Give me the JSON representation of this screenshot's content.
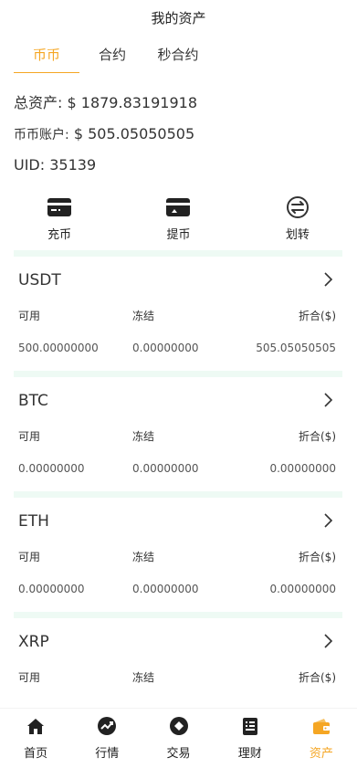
{
  "header": {
    "title": "我的资产"
  },
  "tabs": [
    {
      "label": "币币",
      "active": true
    },
    {
      "label": "合约",
      "active": false
    },
    {
      "label": "秒合约",
      "active": false
    }
  ],
  "summary": {
    "total_label": "总资产:",
    "total_value": "$ 1879.83191918",
    "account_label": "币币账户:",
    "account_value": "$ 505.05050505",
    "uid_label": "UID:",
    "uid_value": "35139"
  },
  "actions": [
    {
      "label": "充币",
      "icon": "card-deposit-icon"
    },
    {
      "label": "提币",
      "icon": "card-withdraw-icon"
    },
    {
      "label": "划转",
      "icon": "transfer-icon"
    }
  ],
  "coins": [
    {
      "name": "USDT",
      "available_label": "可用",
      "frozen_label": "冻结",
      "converted_label": "折合($)",
      "available": "500.00000000",
      "frozen": "0.00000000",
      "converted": "505.05050505"
    },
    {
      "name": "BTC",
      "available_label": "可用",
      "frozen_label": "冻结",
      "converted_label": "折合($)",
      "available": "0.00000000",
      "frozen": "0.00000000",
      "converted": "0.00000000"
    },
    {
      "name": "ETH",
      "available_label": "可用",
      "frozen_label": "冻结",
      "converted_label": "折合($)",
      "available": "0.00000000",
      "frozen": "0.00000000",
      "converted": "0.00000000"
    },
    {
      "name": "XRP",
      "available_label": "可用",
      "frozen_label": "冻结",
      "converted_label": "折合($)"
    }
  ],
  "navbar": [
    {
      "label": "首页",
      "icon": "home-icon",
      "active": false
    },
    {
      "label": "行情",
      "icon": "market-icon",
      "active": false
    },
    {
      "label": "交易",
      "icon": "trade-icon",
      "active": false
    },
    {
      "label": "理财",
      "icon": "finance-icon",
      "active": false
    },
    {
      "label": "资产",
      "icon": "wallet-icon",
      "active": true
    }
  ],
  "colors": {
    "accent": "#f5a623",
    "divider": "#eefaf4",
    "text": "#222222"
  }
}
